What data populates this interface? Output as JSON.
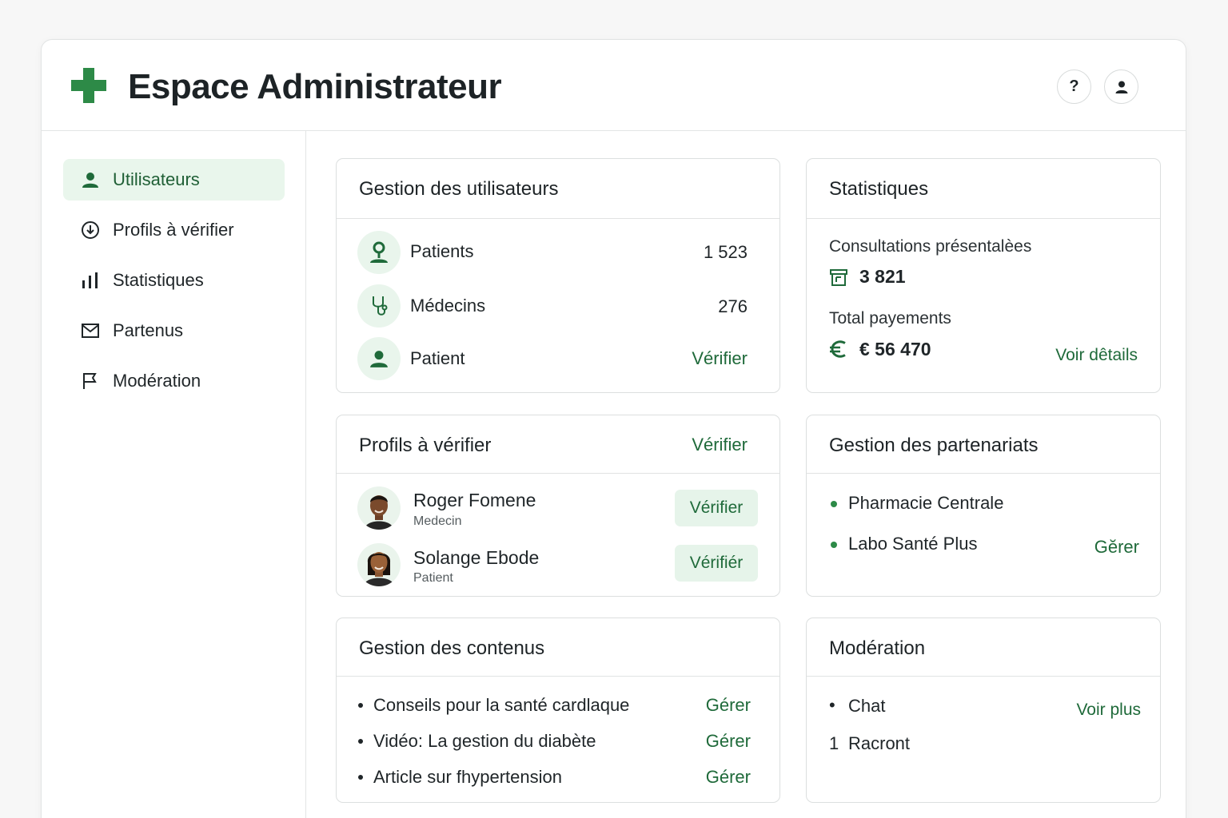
{
  "header": {
    "title": "Espace Administrateur",
    "help_label": "?"
  },
  "sidebar": {
    "items": [
      {
        "label": "Utilisateurs",
        "icon": "user-icon",
        "active": true
      },
      {
        "label": "Profils à vérifier",
        "icon": "shield-check-icon"
      },
      {
        "label": "Statistiques",
        "icon": "bar-chart-icon"
      },
      {
        "label": "Partenus",
        "icon": "mail-icon"
      },
      {
        "label": "Modération",
        "icon": "flag-icon"
      }
    ]
  },
  "users_card": {
    "title": "Gestion des utilisateurs",
    "rows": [
      {
        "label": "Patients",
        "value": "1 523",
        "icon": "patient-icon"
      },
      {
        "label": "Médecins",
        "value": "276",
        "icon": "stethoscope-icon"
      },
      {
        "label": "Patient",
        "action": "Vérifier",
        "icon": "user-icon"
      }
    ]
  },
  "stats_card": {
    "title": "Statistiques",
    "consultations_label": "Consultations présentalèes",
    "consultations_value": "3 821",
    "payments_label": "Total payements",
    "payments_value": "€ 56 470",
    "details_link": "Voir dêtails"
  },
  "profiles_card": {
    "title": "Profils à vérifier",
    "header_action": "Vérifier",
    "people": [
      {
        "name": "Roger Fomene",
        "role": "Medecin",
        "action": "Vérifier"
      },
      {
        "name": "Solange Ebode",
        "role": "Patient",
        "action": "Vérifiér"
      }
    ]
  },
  "partners_card": {
    "title": "Gestion des partenariats",
    "items": [
      "Pharmacie Centrale",
      "Labo Santé Plus"
    ],
    "action": "Gĕrer"
  },
  "content_card": {
    "title": "Gestion des contenus",
    "items": [
      {
        "label": "Conseils pour la santé cardlaque",
        "action": "Gérer"
      },
      {
        "label": "Vidéo: La gestion du diabète",
        "action": "Gérer"
      },
      {
        "label": "Article sur fhypertension",
        "action": "Gérer"
      }
    ]
  },
  "moderation_card": {
    "title": "Modération",
    "items": [
      {
        "marker": "•",
        "label": "Chat"
      },
      {
        "marker": "1",
        "label": "Racront"
      }
    ],
    "action": "Voir plus"
  },
  "colors": {
    "accent": "#1f6a3a",
    "accent_bg": "#e9f6ec",
    "logo": "#2d8a47"
  }
}
